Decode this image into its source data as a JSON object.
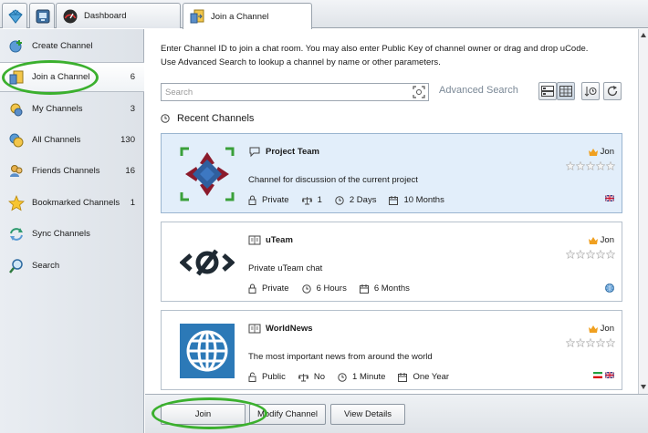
{
  "tabs": {
    "dashboard": "Dashboard",
    "join": "Join a Channel"
  },
  "sidebar": {
    "items": [
      {
        "label": "Create Channel",
        "count": "",
        "icon": "create-channel-icon"
      },
      {
        "label": "Join a Channel",
        "count": "6",
        "icon": "join-channel-icon"
      },
      {
        "label": "My Channels",
        "count": "3",
        "icon": "my-channels-icon"
      },
      {
        "label": "All Channels",
        "count": "130",
        "icon": "all-channels-icon"
      },
      {
        "label": "Friends Channels",
        "count": "16",
        "icon": "friends-channels-icon"
      },
      {
        "label": "Bookmarked Channels",
        "count": "1",
        "icon": "star-icon"
      },
      {
        "label": "Sync Channels",
        "count": "",
        "icon": "sync-icon"
      },
      {
        "label": "Search",
        "count": "",
        "icon": "search-icon"
      }
    ]
  },
  "main": {
    "intro_line1": "Enter Channel ID to join a chat room. You may also enter Public Key of channel owner or drag and drop uCode.",
    "intro_line2": "Use Advanced Search to lookup a channel by name or other parameters.",
    "search_placeholder": "Search",
    "advanced_search": "Advanced Search",
    "recent_title": "Recent Channels"
  },
  "channels": [
    {
      "name": "Project Team",
      "description": "Channel for discussion of the current project",
      "owner": "Jon",
      "access": "Private",
      "members": "1",
      "age": "2 Days",
      "expires": "10 Months",
      "flags": [
        "uk"
      ],
      "selected": true
    },
    {
      "name": "uTeam",
      "description": "Private uTeam chat",
      "owner": "Jon",
      "access": "Private",
      "age": "6 Hours",
      "expires": "6 Months",
      "flags": [
        "globe"
      ],
      "selected": false
    },
    {
      "name": "WorldNews",
      "description": "The most important news from around the world",
      "owner": "Jon",
      "access": "Public",
      "members": "No",
      "age": "1 Minute",
      "expires": "One Year",
      "flags": [
        "ir",
        "uk"
      ],
      "selected": false
    }
  ],
  "buttons": {
    "join": "Join",
    "modify": "Modify Channel",
    "details": "View Details"
  },
  "colors": {
    "accent_ring": "#3bb02e",
    "selected_card": "#e2eefa",
    "owner_crown": "#f0a020"
  }
}
